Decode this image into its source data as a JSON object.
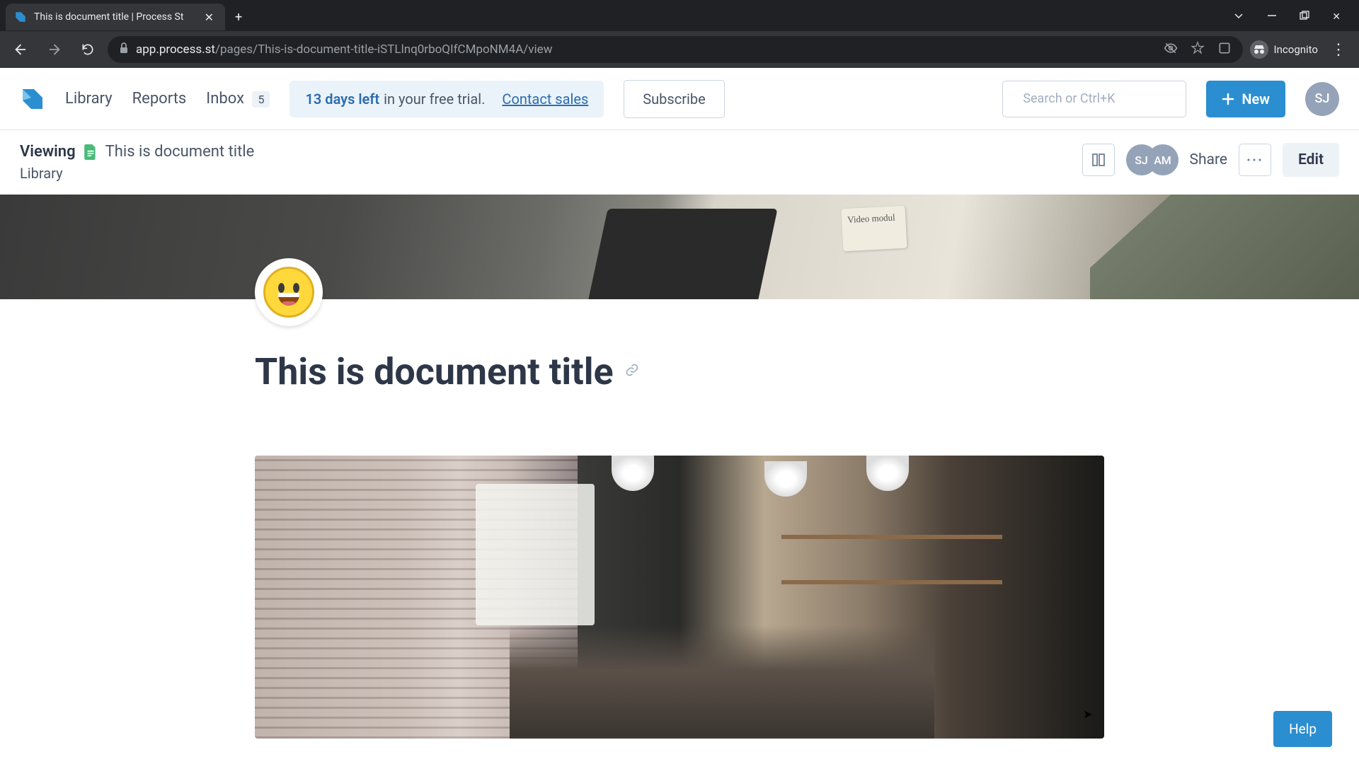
{
  "browser": {
    "tab_title": "This is document title | Process St",
    "url_host": "app.process.st",
    "url_path": "/pages/This-is-document-title-iSTLlnq0rboQIfCMpoNM4A/view",
    "incognito_label": "Incognito"
  },
  "header": {
    "nav": {
      "library": "Library",
      "reports": "Reports",
      "inbox": "Inbox"
    },
    "inbox_count": "5",
    "trial": {
      "days": "13 days left",
      "text": "in your free trial.",
      "contact": "Contact sales"
    },
    "subscribe": "Subscribe",
    "search_placeholder": "Search or Ctrl+K",
    "new_button": "New",
    "user_initials": "SJ"
  },
  "docbar": {
    "viewing": "Viewing",
    "title": "This is document title",
    "breadcrumb": "Library",
    "avatars": [
      "SJ",
      "AM"
    ],
    "share": "Share",
    "more": "···",
    "edit": "Edit"
  },
  "document": {
    "emoji": "grinning-face",
    "title": "This is document title"
  },
  "help": "Help"
}
